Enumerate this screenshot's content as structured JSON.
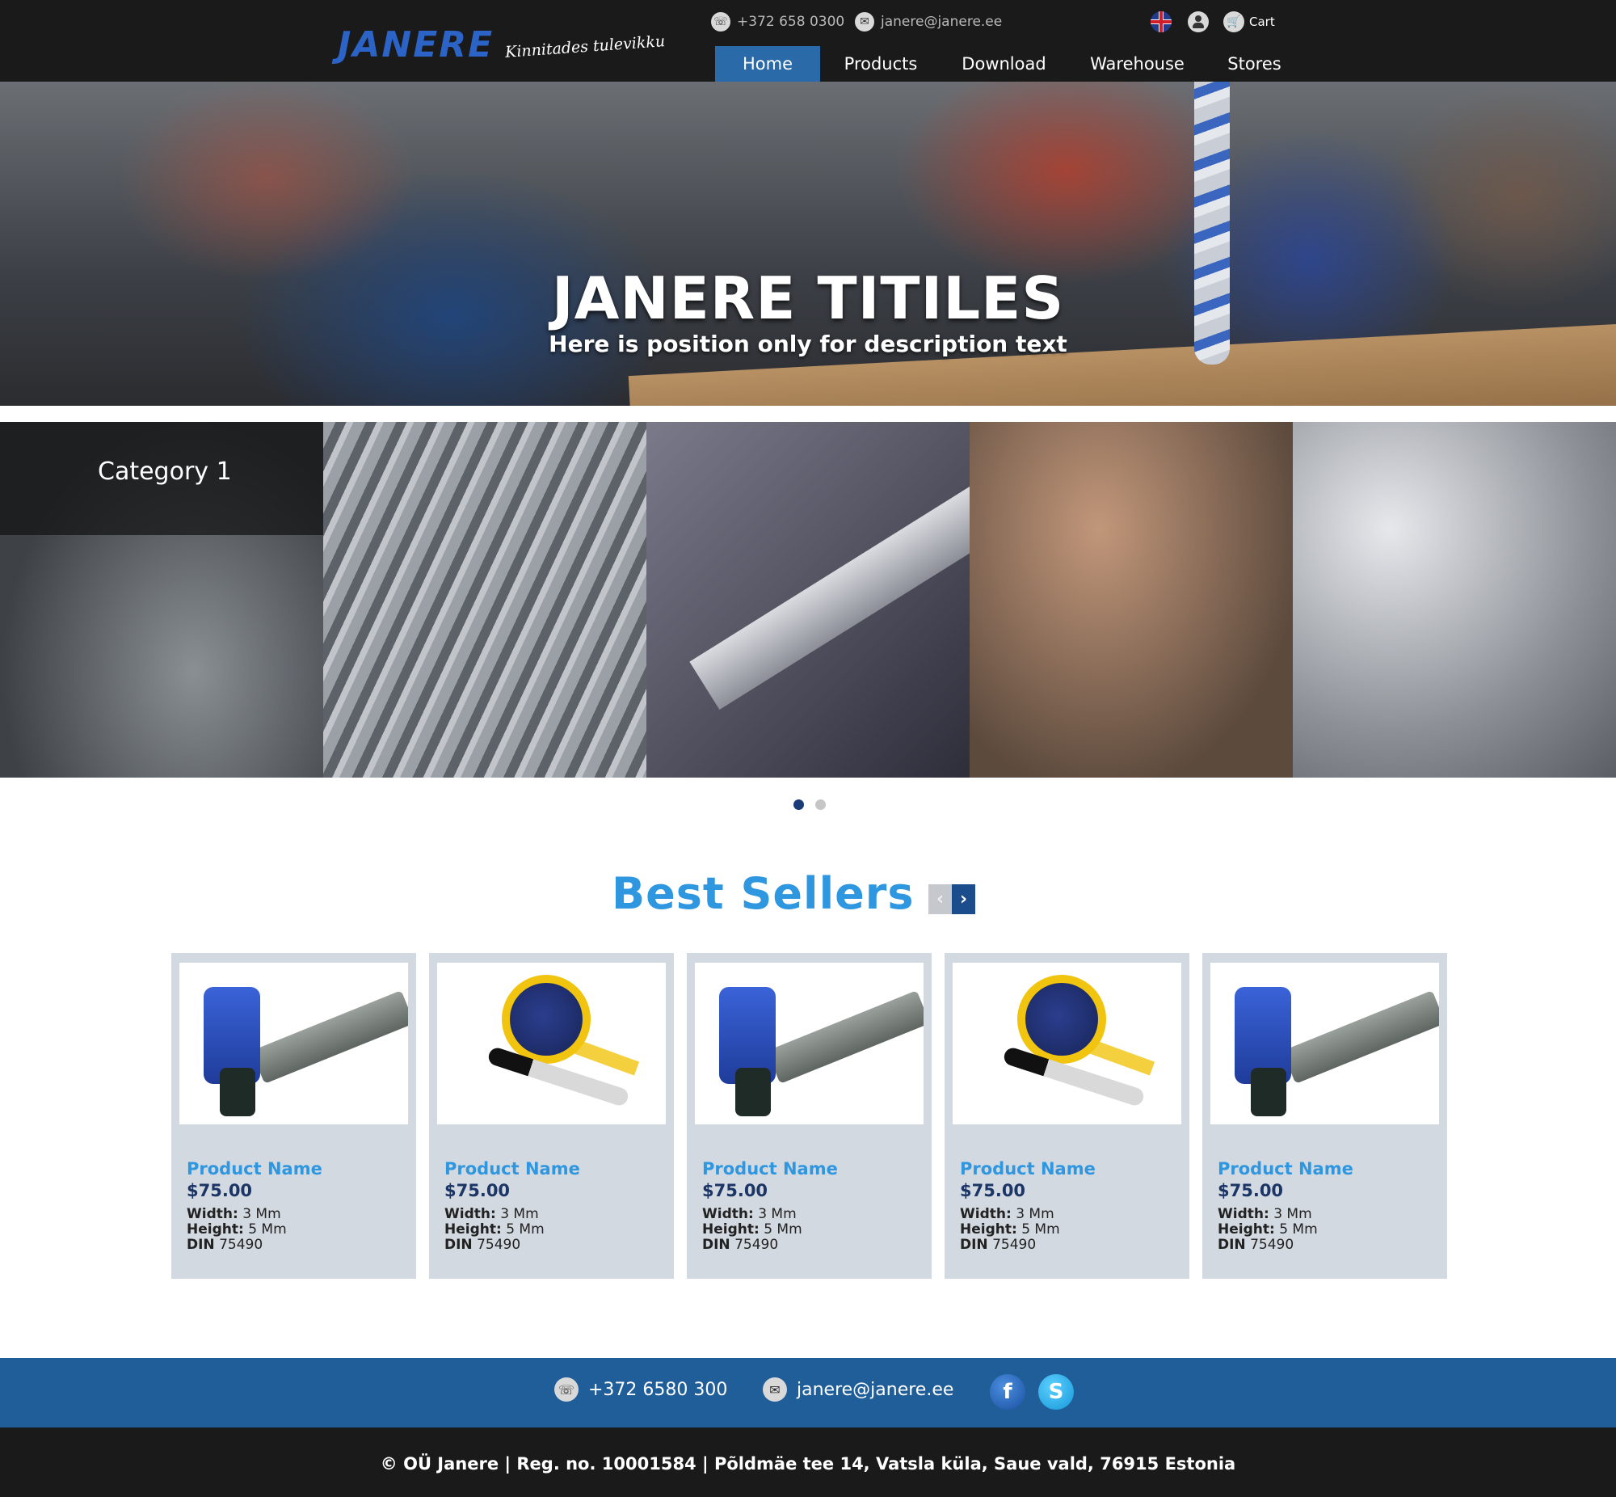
{
  "header": {
    "logo": "JANERE",
    "tagline": "Kinnitades tulevikku",
    "phone": "+372 658 0300",
    "email": "janere@janere.ee",
    "cart_label": "Cart",
    "icons": [
      "phone-icon",
      "email-icon",
      "uk-flag-icon",
      "user-icon",
      "cart-icon"
    ]
  },
  "nav": {
    "items": [
      {
        "label": "Home",
        "active": true
      },
      {
        "label": "Products",
        "active": false
      },
      {
        "label": "Download",
        "active": false
      },
      {
        "label": "Warehouse",
        "active": false
      },
      {
        "label": "Stores",
        "active": false
      }
    ]
  },
  "hero": {
    "title": "JANERE TITILES",
    "subtitle": "Here is position only for description text"
  },
  "categories": {
    "active_label": "Category 1",
    "carousel_dots": 2,
    "active_dot": 0
  },
  "best_sellers": {
    "title": "Best Sellers",
    "products": [
      {
        "name": "Product Name",
        "price": "$75.00",
        "width_label": "Width:",
        "width": "3 Mm",
        "height_label": "Height:",
        "height": "5 Mm",
        "din_label": "DIN",
        "din": "75490",
        "image": "nail-gun"
      },
      {
        "name": "Product Name",
        "price": "$75.00",
        "width_label": "Width:",
        "width": "3 Mm",
        "height_label": "Height:",
        "height": "5 Mm",
        "din_label": "DIN",
        "din": "75490",
        "image": "tape-measure"
      },
      {
        "name": "Product Name",
        "price": "$75.00",
        "width_label": "Width:",
        "width": "3 Mm",
        "height_label": "Height:",
        "height": "5 Mm",
        "din_label": "DIN",
        "din": "75490",
        "image": "nail-gun"
      },
      {
        "name": "Product Name",
        "price": "$75.00",
        "width_label": "Width:",
        "width": "3 Mm",
        "height_label": "Height:",
        "height": "5 Mm",
        "din_label": "DIN",
        "din": "75490",
        "image": "tape-measure"
      },
      {
        "name": "Product Name",
        "price": "$75.00",
        "width_label": "Width:",
        "width": "3 Mm",
        "height_label": "Height:",
        "height": "5 Mm",
        "din_label": "DIN",
        "din": "75490",
        "image": "nail-gun"
      }
    ]
  },
  "footer": {
    "phone": "+372 6580 300",
    "email": "janere@janere.ee",
    "copyright": "© OÜ Janere | Reg. no. 10001584 | Põldmäe tee 14, Vatsla küla, Saue vald, 76915 Estonia"
  },
  "colors": {
    "nav_active": "#2a6aa8",
    "accent_blue": "#2f96e0",
    "price_navy": "#1b3566",
    "footer_blue": "#205e99",
    "header_dark": "#1a1a1a"
  }
}
